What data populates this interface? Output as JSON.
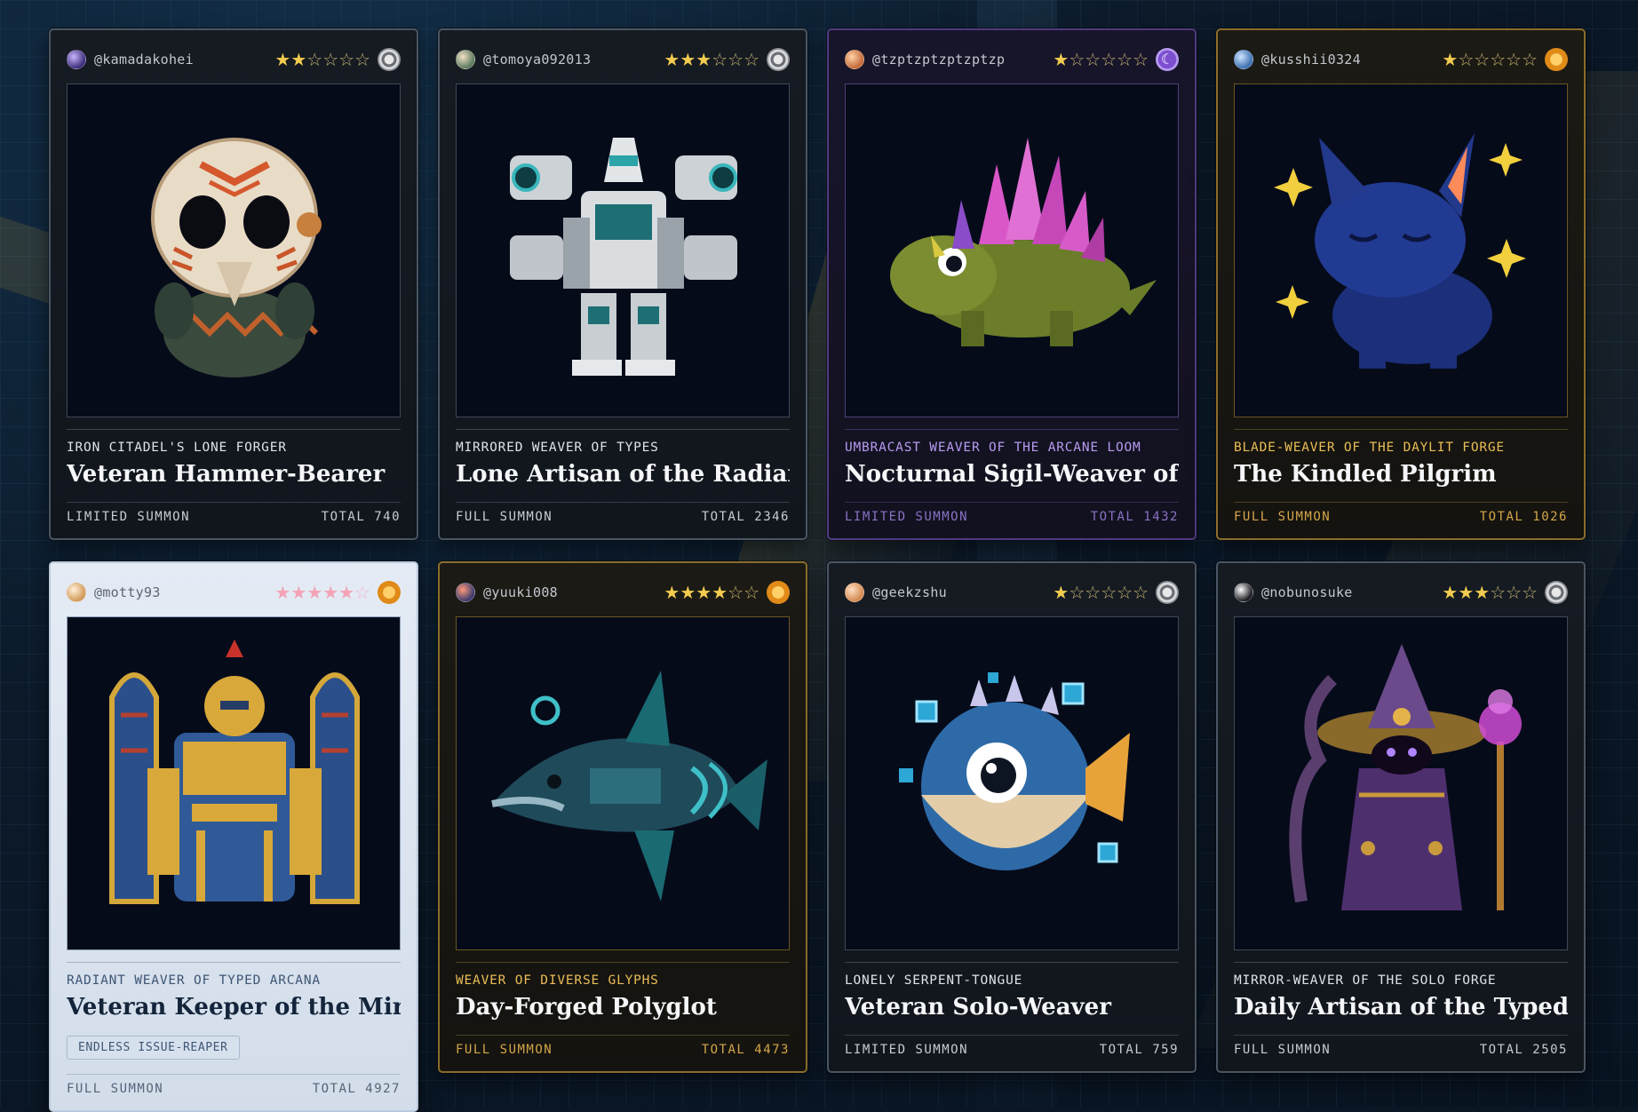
{
  "cards": [
    {
      "handle": "@kamadakohei",
      "stars": 2,
      "star_str_on": "★★",
      "star_str_off": "☆☆☆☆",
      "tier_icon": "silver-emblem-icon",
      "subtitle": "IRON CITADEL'S LONE FORGER",
      "name": "Veteran Hammer-Bearer",
      "summon": "LIMITED SUMMON",
      "total": "TOTAL 740",
      "art": "masked-creature-art"
    },
    {
      "handle": "@tomoya092013",
      "stars": 3,
      "star_str_on": "★★★",
      "star_str_off": "☆☆☆",
      "tier_icon": "silver-emblem-icon",
      "subtitle": "MIRRORED WEAVER OF TYPES",
      "name": "Lone Artisan of the Radiant···",
      "summon": "FULL SUMMON",
      "total": "TOTAL 2346",
      "art": "mech-robot-art"
    },
    {
      "handle": "@tzptzptzptzptzp",
      "stars": 1,
      "star_str_on": "★",
      "star_str_off": "☆☆☆☆☆",
      "tier_icon": "moon-emblem-icon",
      "subtitle": "UMBRACAST WEAVER OF THE ARCANE LOOM",
      "name": "Nocturnal Sigil-Weaver of···",
      "summon": "LIMITED SUMMON",
      "total": "TOTAL 1432",
      "art": "crystal-lizard-art"
    },
    {
      "handle": "@kusshii0324",
      "stars": 1,
      "star_str_on": "★",
      "star_str_off": "☆☆☆☆☆",
      "tier_icon": "sun-emblem-icon",
      "subtitle": "BLADE-WEAVER OF THE DAYLIT FORGE",
      "name": "The Kindled Pilgrim",
      "summon": "FULL SUMMON",
      "total": "TOTAL 1026",
      "art": "star-cat-art"
    },
    {
      "handle": "@motty93",
      "stars": 5,
      "star_str_on": "★★★★★",
      "star_str_off": "☆",
      "tier_icon": "sun-emblem-icon",
      "subtitle": "RADIANT WEAVER OF TYPED ARCANA",
      "name": "Veteran Keeper of the Mirr···",
      "chip": "ENDLESS ISSUE-REAPER",
      "summon": "FULL SUMMON",
      "total": "TOTAL 4927",
      "art": "golden-knight-art"
    },
    {
      "handle": "@yuuki008",
      "stars": 4,
      "star_str_on": "★★★★",
      "star_str_off": "☆☆",
      "tier_icon": "sun-emblem-icon",
      "subtitle": "WEAVER OF DIVERSE GLYPHS",
      "name": "Day-Forged Polyglot",
      "summon": "FULL SUMMON",
      "total": "TOTAL 4473",
      "art": "armored-dolphin-art"
    },
    {
      "handle": "@geekzshu",
      "stars": 1,
      "star_str_on": "★",
      "star_str_off": "☆☆☆☆☆",
      "tier_icon": "silver-emblem-icon",
      "subtitle": "LONELY SERPENT-TONGUE",
      "name": "Veteran Solo-Weaver",
      "summon": "LIMITED SUMMON",
      "total": "TOTAL 759",
      "art": "pufferfish-art"
    },
    {
      "handle": "@nobunosuke",
      "stars": 3,
      "star_str_on": "★★★",
      "star_str_off": "☆☆☆",
      "tier_icon": "silver-emblem-icon",
      "subtitle": "MIRROR-WEAVER OF THE SOLO FORGE",
      "name": "Daily Artisan of the Typed···",
      "summon": "FULL SUMMON",
      "total": "TOTAL 2505",
      "art": "dark-wizard-art"
    }
  ]
}
